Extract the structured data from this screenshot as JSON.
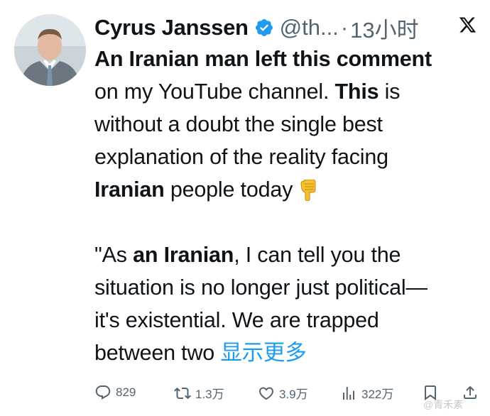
{
  "author": {
    "name": "Cyrus Janssen",
    "handle": "@th...",
    "separator": "·",
    "time": "13小时"
  },
  "icons": {
    "avatar": "author-avatar",
    "verified": "verified-badge-icon",
    "platform": "x-logo-icon",
    "emoji": "pointing-down-emoji"
  },
  "colors": {
    "link": "#1d9bf0",
    "secondary": "#536471",
    "text": "#0f1419"
  },
  "tweet": {
    "l1": "An Iranian man left this comment",
    "l2a": "on my YouTube channel. ",
    "l2b": "This",
    "l2c": " is",
    "l3": "without a doubt the single best",
    "l4": "explanation of the reality facing",
    "l5a": "Iranian",
    "l5b": " people today ",
    "l6a": "\"As ",
    "l6b": "an Iranian",
    "l6c": ", I can tell you the",
    "l7": "situation is no longer just political—",
    "l8": "it's existential. We are trapped",
    "l9": "between two ",
    "more": "显示更多"
  },
  "actions": {
    "replies": "829",
    "reposts": "1.3万",
    "likes": "3.9万",
    "views": "322万"
  },
  "watermark": "@青禾素"
}
